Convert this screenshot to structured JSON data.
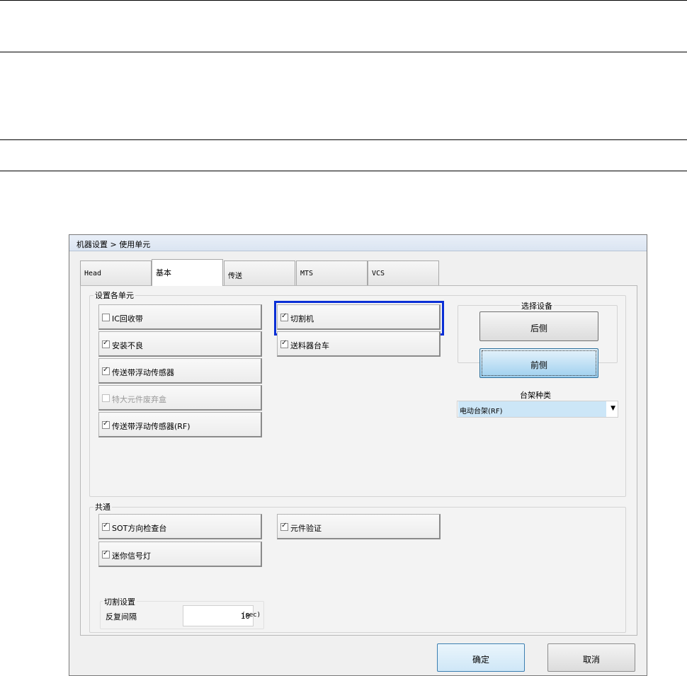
{
  "dialog": {
    "title": "机器设置 > 使用单元"
  },
  "tabs": [
    {
      "label": "Head",
      "active": false
    },
    {
      "label": "基本",
      "active": true
    },
    {
      "label": "传送",
      "active": false
    },
    {
      "label": "MTS",
      "active": false
    },
    {
      "label": "VCS",
      "active": false
    }
  ],
  "units_group": {
    "label": "设置各单元",
    "items": [
      {
        "label": "IC回收带",
        "checked": false,
        "enabled": true
      },
      {
        "label": "安装不良",
        "checked": true,
        "enabled": true
      },
      {
        "label": "传送带浮动传感器",
        "checked": true,
        "enabled": true
      },
      {
        "label": "特大元件废弃盒",
        "checked": false,
        "enabled": false
      },
      {
        "label": "传送带浮动传感器(RF)",
        "checked": true,
        "enabled": true
      },
      {
        "label": "切割机",
        "checked": true,
        "enabled": true,
        "highlighted": true
      },
      {
        "label": "送料器台车",
        "checked": true,
        "enabled": true
      }
    ]
  },
  "select_device": {
    "label": "选择设备",
    "buttons": [
      {
        "label": "后侧",
        "active": false
      },
      {
        "label": "前侧",
        "active": true
      }
    ]
  },
  "rack_type": {
    "label": "台架种类",
    "value": "电动台架(RF)"
  },
  "common_group": {
    "label": "共通",
    "items": [
      {
        "label": "SOT方向检查台",
        "checked": true
      },
      {
        "label": "迷你信号灯",
        "checked": true
      },
      {
        "label": "元件验证",
        "checked": true
      }
    ]
  },
  "cut_settings": {
    "label": "切割设置",
    "interval_label": "反复间隔",
    "interval_value": "10",
    "unit": "(sec)"
  },
  "footer": {
    "ok_label": "确定",
    "cancel_label": "取消"
  },
  "colors": {
    "highlight": "#0a2fd6",
    "selected_select": "#cce6f7"
  }
}
